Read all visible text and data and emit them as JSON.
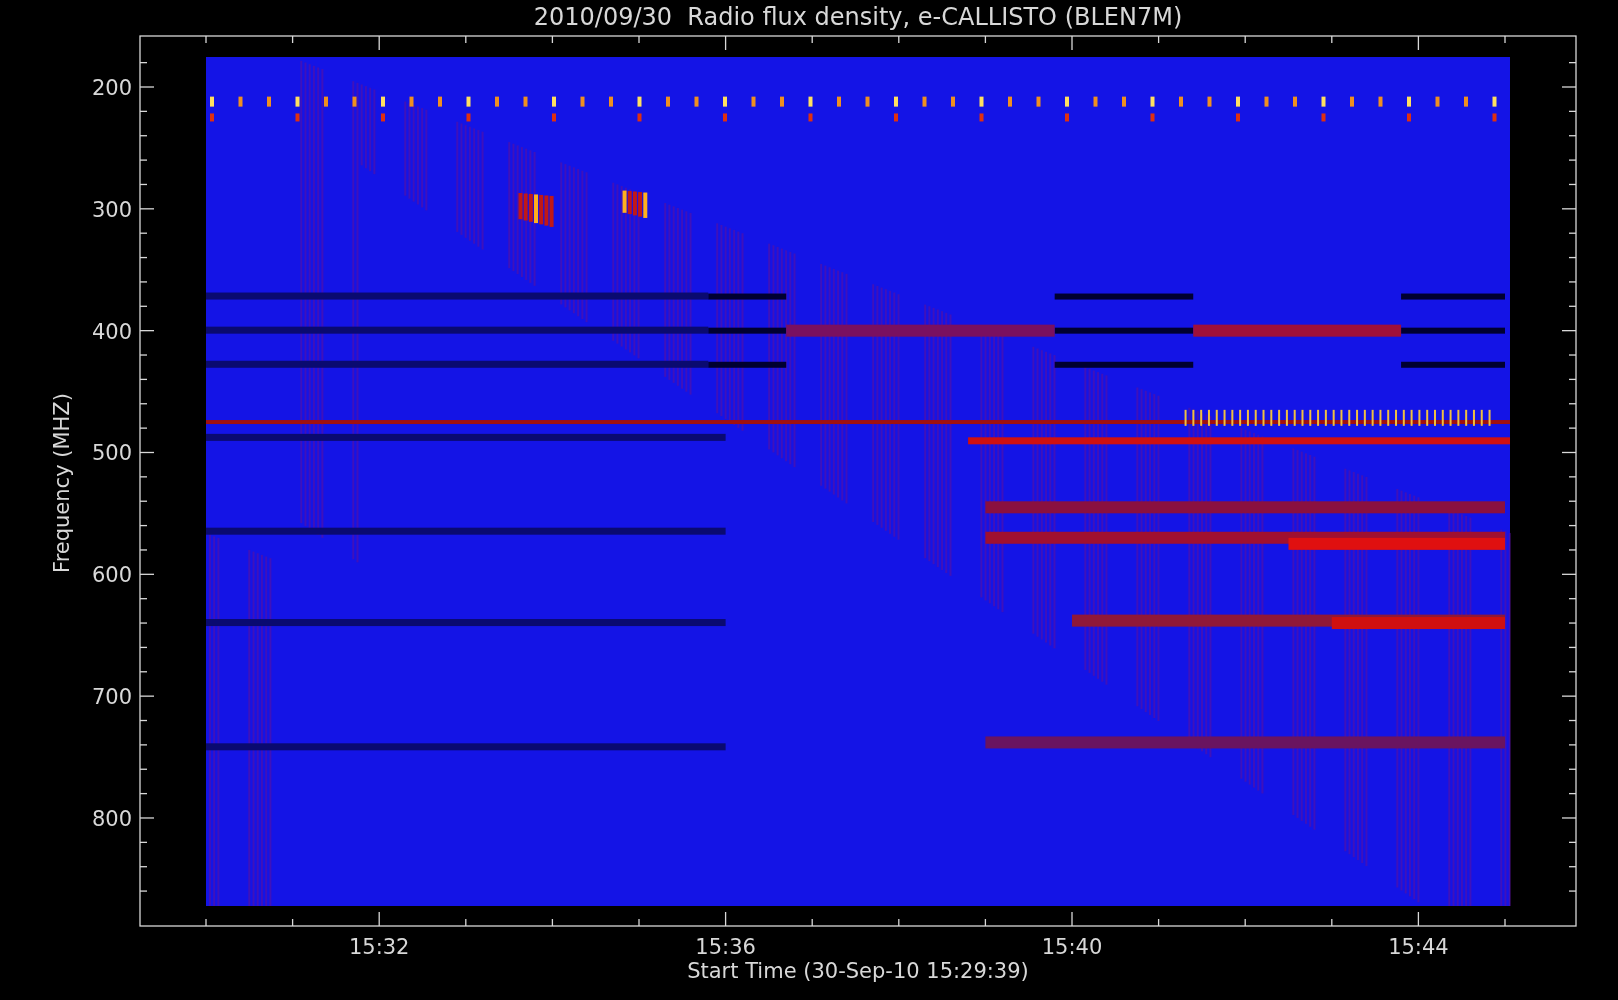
{
  "title": "2010/09/30  Radio flux density, e-CALLISTO (BLEN7M)",
  "y_axis": {
    "label": "Frequency (MHZ)",
    "ticks": [
      "200",
      "300",
      "400",
      "500",
      "600",
      "700",
      "800"
    ]
  },
  "x_axis": {
    "label": "Start Time (30-Sep-10 15:29:39)",
    "ticks": [
      "15:32",
      "15:36",
      "15:40",
      "15:44"
    ]
  }
}
